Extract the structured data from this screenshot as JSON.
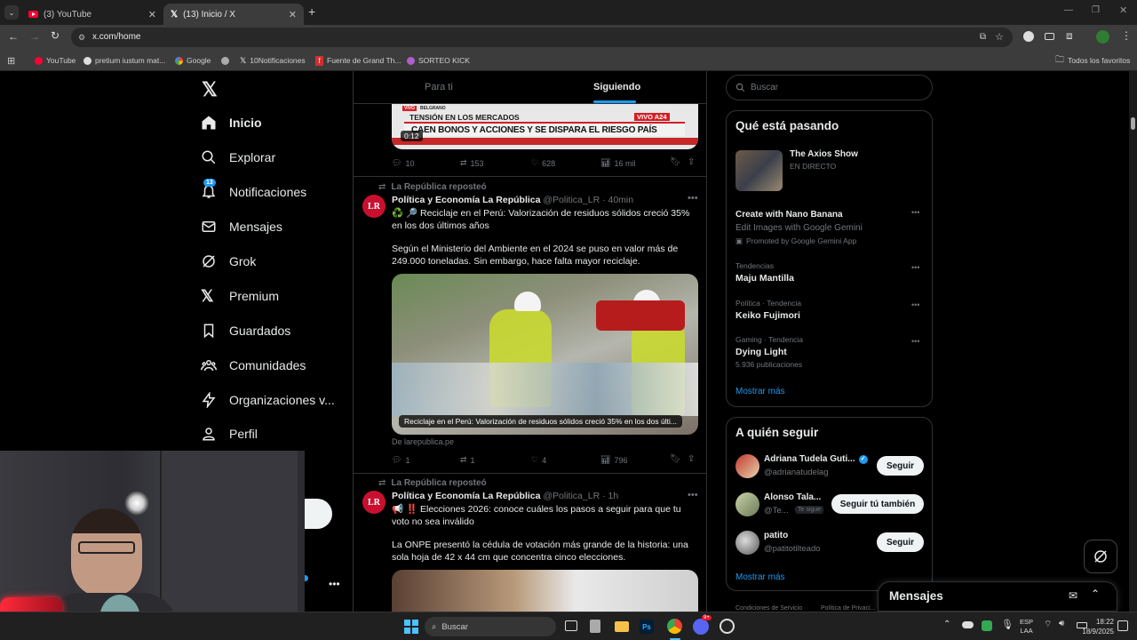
{
  "browser": {
    "tabs": [
      {
        "label": "(3) YouTube"
      },
      {
        "label": "(13) Inicio / X"
      }
    ],
    "url": "x.com/home",
    "bookmarks": [
      {
        "label": "YouTube"
      },
      {
        "label": "pretium iustum mat..."
      },
      {
        "label": "Google"
      },
      {
        "label": ""
      },
      {
        "label": "10Notificaciones"
      },
      {
        "label": "Fuente de Grand Th..."
      },
      {
        "label": "SORTEO KICK"
      }
    ],
    "all_favorites": "Todos los favoritos"
  },
  "sidebar": {
    "items": [
      {
        "label": "Inicio",
        "icon": "home-icon"
      },
      {
        "label": "Explorar",
        "icon": "search-icon"
      },
      {
        "label": "Notificaciones",
        "icon": "bell-icon",
        "badge": "13"
      },
      {
        "label": "Mensajes",
        "icon": "mail-icon"
      },
      {
        "label": "Grok",
        "icon": "grok-icon"
      },
      {
        "label": "Premium",
        "icon": "x-icon"
      },
      {
        "label": "Guardados",
        "icon": "bookmark-icon"
      },
      {
        "label": "Comunidades",
        "icon": "people-icon"
      },
      {
        "label": "Organizaciones v...",
        "icon": "bolt-icon"
      },
      {
        "label": "Perfil",
        "icon": "person-icon"
      }
    ]
  },
  "feed": {
    "tab_for_you": "Para ti",
    "tab_following": "Siguiendo",
    "top_tweet": {
      "video_time": "0:12",
      "news_tag": "VIVO",
      "news_location": "BELGRANO",
      "news_headline_1": "TENSIÓN EN LOS MERCADOS",
      "news_headline_2": "CAEN BONOS Y ACCIONES Y SE DISPARA EL RIESGO PAÍS",
      "news_live": "VIVO",
      "news_channel": "A24",
      "replies": "10",
      "reposts": "153",
      "likes": "628",
      "views": "16 mil"
    },
    "tweet1": {
      "repost_line": "La República reposteó",
      "name": "Política y Economía La República",
      "handle": "@Politica_LR",
      "time": "· 40min",
      "text1": "♻️ 🔎 Reciclaje en el Perú: Valorización de residuos sólidos creció 35% en los dos últimos años",
      "text2": "Según el Ministerio del Ambiente en el 2024 se puso en valor más de 249.000 toneladas. Sin embargo, hace falta mayor reciclaje.",
      "card_caption": "Reciclaje en el Perú: Valorización de residuos sólidos creció 35% en los dos últi...",
      "card_source": "De larepublica.pe",
      "replies": "1",
      "reposts": "1",
      "likes": "4",
      "views": "796"
    },
    "tweet2": {
      "repost_line": "La República reposteó",
      "name": "Política y Economía La República",
      "handle": "@Politica_LR",
      "time": "· 1h",
      "text1": "📢 ‼️ Elecciones 2026: conoce cuáles los pasos a seguir para que tu voto no sea inválido",
      "text2": "La ONPE presentó la cédula de votación más grande de la historia: una sola hoja de 42 x 44 cm que concentra cinco elecciones."
    }
  },
  "right": {
    "search_placeholder": "Buscar",
    "trending_title": "Qué está pasando",
    "live": {
      "title": "The Axios Show",
      "status": "EN DIRECTO"
    },
    "promo": {
      "title": "Create with Nano Banana",
      "sub": "Edit Images with Google Gemini",
      "promoted": "Promoted by Google Gemini App"
    },
    "trends": [
      {
        "category": "Tendencias",
        "name": "Maju Mantilla",
        "count": ""
      },
      {
        "category": "Política · Tendencia",
        "name": "Keiko Fujimori",
        "count": ""
      },
      {
        "category": "Gaming · Tendencia",
        "name": "Dying Light",
        "count": "5.936 publicaciones"
      }
    ],
    "show_more": "Mostrar más",
    "follow_title": "A quién seguir",
    "follow": [
      {
        "name": "Adriana Tudela Guti...",
        "handle": "@adrianatudelag",
        "button": "Seguir",
        "follows_you": ""
      },
      {
        "name": "Alonso Tala...",
        "handle": "@Te...",
        "button": "Seguir tú también",
        "follows_you": "Te sigue"
      },
      {
        "name": "patito",
        "handle": "@patitotilteado",
        "button": "Seguir",
        "follows_you": ""
      }
    ],
    "show_more2": "Mostrar más",
    "footer_links": [
      "Condiciones de Servicio",
      "Política de Privaci..."
    ]
  },
  "messages_drawer": {
    "title": "Mensajes"
  },
  "taskbar": {
    "search_placeholder": "Buscar",
    "lang1": "ESP",
    "lang2": "LAA",
    "time": "18:22",
    "date": "18/9/2025",
    "discord_badge": "9+"
  },
  "colors": {
    "accent": "#1d9bf0",
    "bg": "#000000",
    "border": "#2f3336",
    "muted": "#71767b"
  }
}
